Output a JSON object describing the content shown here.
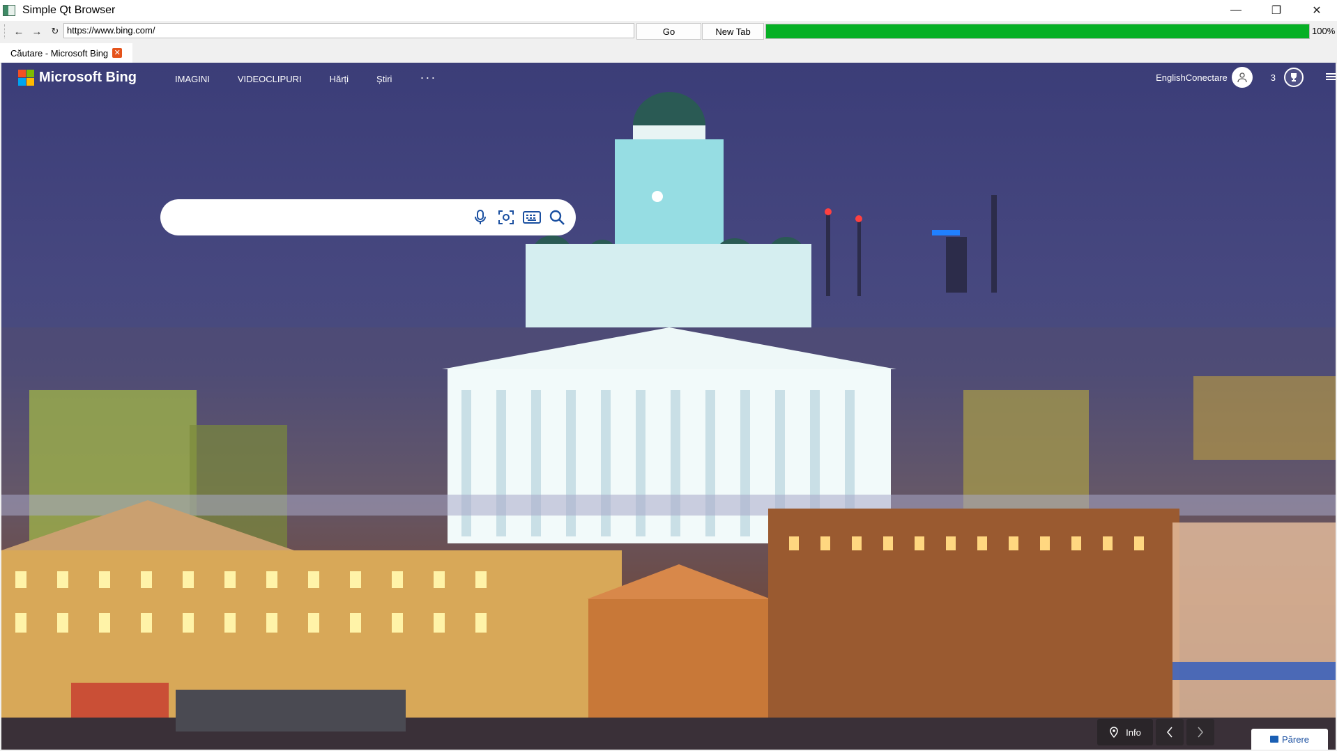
{
  "window": {
    "title": "Simple Qt Browser",
    "icon": "app-icon",
    "controls": {
      "minimize": "—",
      "restore": "❐",
      "close": "✕"
    }
  },
  "nav": {
    "back": "←",
    "forward": "→",
    "reload": "↻",
    "url": "https://www.bing.com/",
    "go_label": "Go",
    "new_tab_label": "New Tab",
    "progress_value": 100,
    "progress_text": "100%",
    "progress_color": "#06b025"
  },
  "tabs": [
    {
      "label": "Căutare - Microsoft Bing",
      "close": "✕",
      "active": true
    }
  ],
  "bing": {
    "logo_text": "Microsoft Bing",
    "logo_colors": [
      "#f25022",
      "#7fba00",
      "#00a4ef",
      "#ffb900"
    ],
    "nav_items": [
      "IMAGINI",
      "VIDEOCLIPURI",
      "Hărți",
      "Știri"
    ],
    "more": "···",
    "header_right": {
      "language_signin": "EnglishConectare",
      "rewards_count": "3"
    },
    "search": {
      "placeholder": "",
      "value": ""
    },
    "footer": {
      "info_label": "Info",
      "feedback_label": "Părere"
    }
  }
}
